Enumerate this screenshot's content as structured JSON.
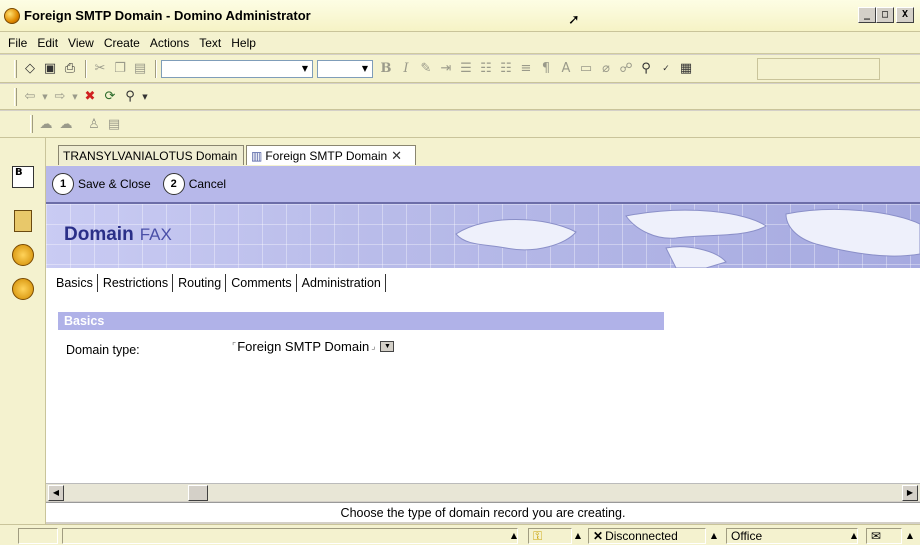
{
  "window": {
    "title": "Foreign SMTP Domain - Domino Administrator",
    "minimize": "_",
    "maximize": "□",
    "close": "X"
  },
  "menu": {
    "items": [
      "File",
      "Edit",
      "View",
      "Create",
      "Actions",
      "Text",
      "Help"
    ]
  },
  "doc_tabs": [
    {
      "label": "TRANSYLVANIALOTUS Domain",
      "active": false
    },
    {
      "label": "Foreign SMTP Domain",
      "active": true
    }
  ],
  "actions": {
    "save_close": {
      "label": "Save & Close",
      "key": "1"
    },
    "cancel": {
      "label": "Cancel",
      "key": "2"
    }
  },
  "banner": {
    "title_bold": "Domain",
    "title_light": "FAX"
  },
  "form_tabs": [
    "Basics",
    "Restrictions",
    "Routing",
    "Comments",
    "Administration"
  ],
  "section": {
    "header": "Basics",
    "field_label": "Domain type:",
    "field_value": "Foreign SMTP Domain"
  },
  "hint": "Choose the type of domain record you are creating.",
  "status": {
    "connection": "Disconnected",
    "location": "Office"
  },
  "colors": {
    "action_bar": "#b7b8ea",
    "section_header": "#b0b2e8",
    "banner_text": "#2a2f88"
  }
}
